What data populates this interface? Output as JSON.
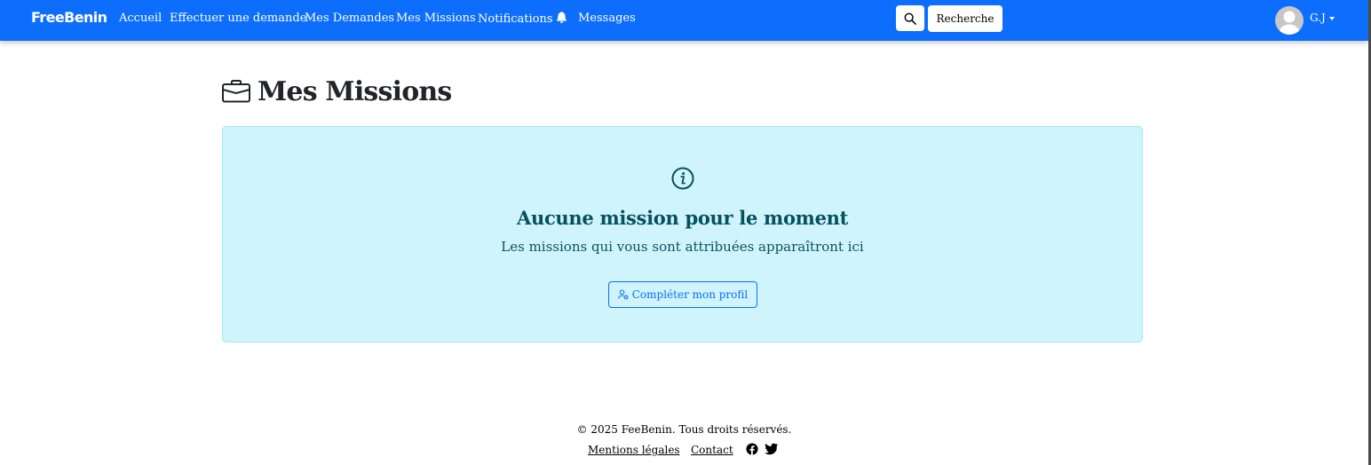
{
  "navbar": {
    "brand": "FreeBenin",
    "links": [
      "Accueil",
      "Effectuer une demande",
      "Mes Demandes",
      "Mes Missions",
      "Notifications",
      "Messages"
    ],
    "search_label": "Recherche",
    "user": "G.J",
    "colors": {
      "primary": "#0d6efd"
    }
  },
  "main": {
    "title": "Mes Missions",
    "alert": {
      "title": "Aucune mission pour le moment",
      "subtitle": "Les missions qui vous sont attribuées apparaîtront ici",
      "button": "Compléter mon profil",
      "colors": {
        "background": "#cff4fc",
        "text": "#055160"
      }
    }
  },
  "footer": {
    "copyright": "© 2025 FeeBenin. Tous droits réservés.",
    "links": [
      "Mentions légales",
      "Contact"
    ],
    "social_icons": [
      "facebook-icon",
      "twitter-icon"
    ]
  }
}
